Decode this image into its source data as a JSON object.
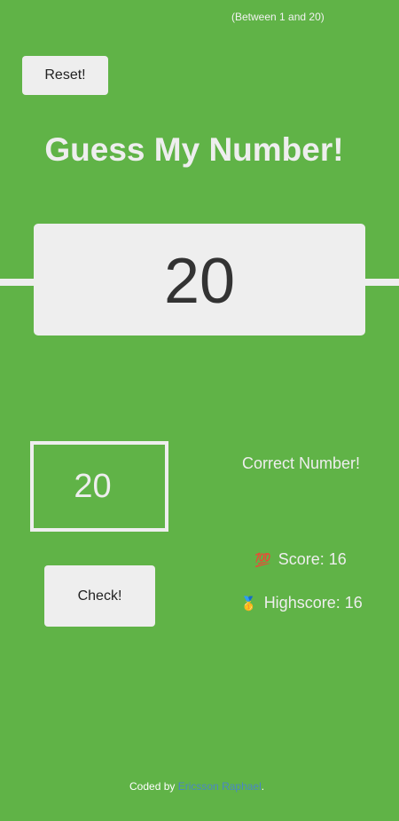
{
  "header": {
    "between_text": "(Between 1 and 20)",
    "reset_label": "Reset!",
    "title": "Guess My Number!"
  },
  "secret": {
    "number": "20"
  },
  "guess": {
    "value": "20"
  },
  "controls": {
    "check_label": "Check!"
  },
  "status": {
    "message": "Correct Number!",
    "score_icon": "💯",
    "score_label": "Score:",
    "score_value": "16",
    "highscore_icon": "🥇",
    "highscore_label": "Highscore:",
    "highscore_value": "16"
  },
  "footer": {
    "prefix": "Coded by",
    "author": "Ericsson Raphael",
    "suffix": "."
  },
  "colors": {
    "background": "#60b347",
    "light": "#eeeeee",
    "link": "#4a86c5"
  }
}
